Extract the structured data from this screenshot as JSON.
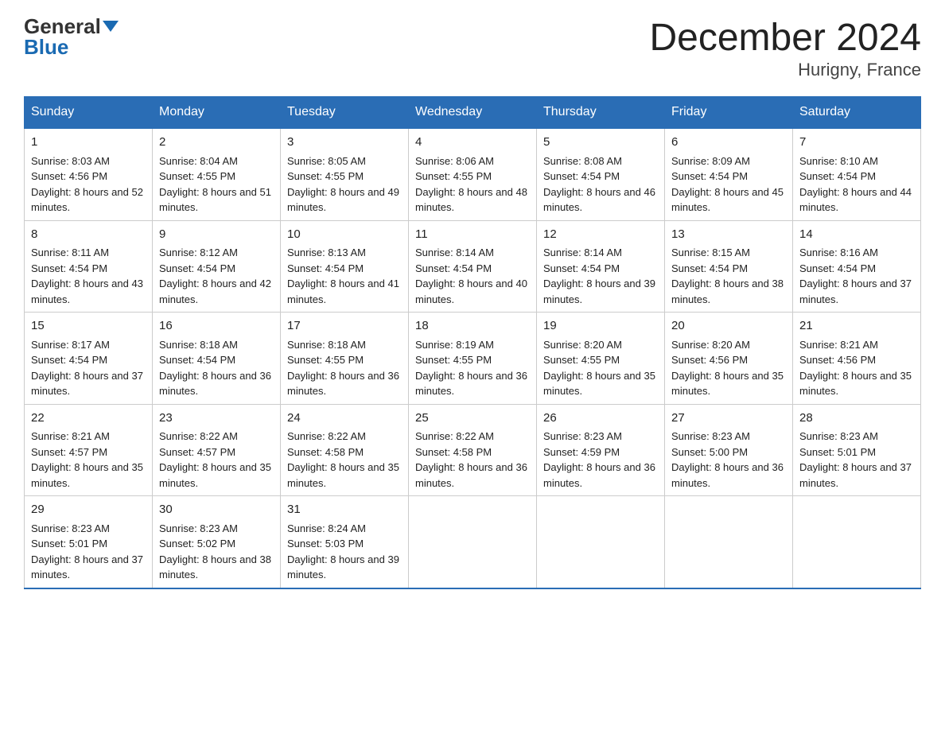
{
  "header": {
    "logo_general": "General",
    "logo_blue": "Blue",
    "month_title": "December 2024",
    "location": "Hurigny, France"
  },
  "days_of_week": [
    "Sunday",
    "Monday",
    "Tuesday",
    "Wednesday",
    "Thursday",
    "Friday",
    "Saturday"
  ],
  "weeks": [
    [
      {
        "day": "1",
        "sunrise": "8:03 AM",
        "sunset": "4:56 PM",
        "daylight": "8 hours and 52 minutes."
      },
      {
        "day": "2",
        "sunrise": "8:04 AM",
        "sunset": "4:55 PM",
        "daylight": "8 hours and 51 minutes."
      },
      {
        "day": "3",
        "sunrise": "8:05 AM",
        "sunset": "4:55 PM",
        "daylight": "8 hours and 49 minutes."
      },
      {
        "day": "4",
        "sunrise": "8:06 AM",
        "sunset": "4:55 PM",
        "daylight": "8 hours and 48 minutes."
      },
      {
        "day": "5",
        "sunrise": "8:08 AM",
        "sunset": "4:54 PM",
        "daylight": "8 hours and 46 minutes."
      },
      {
        "day": "6",
        "sunrise": "8:09 AM",
        "sunset": "4:54 PM",
        "daylight": "8 hours and 45 minutes."
      },
      {
        "day": "7",
        "sunrise": "8:10 AM",
        "sunset": "4:54 PM",
        "daylight": "8 hours and 44 minutes."
      }
    ],
    [
      {
        "day": "8",
        "sunrise": "8:11 AM",
        "sunset": "4:54 PM",
        "daylight": "8 hours and 43 minutes."
      },
      {
        "day": "9",
        "sunrise": "8:12 AM",
        "sunset": "4:54 PM",
        "daylight": "8 hours and 42 minutes."
      },
      {
        "day": "10",
        "sunrise": "8:13 AM",
        "sunset": "4:54 PM",
        "daylight": "8 hours and 41 minutes."
      },
      {
        "day": "11",
        "sunrise": "8:14 AM",
        "sunset": "4:54 PM",
        "daylight": "8 hours and 40 minutes."
      },
      {
        "day": "12",
        "sunrise": "8:14 AM",
        "sunset": "4:54 PM",
        "daylight": "8 hours and 39 minutes."
      },
      {
        "day": "13",
        "sunrise": "8:15 AM",
        "sunset": "4:54 PM",
        "daylight": "8 hours and 38 minutes."
      },
      {
        "day": "14",
        "sunrise": "8:16 AM",
        "sunset": "4:54 PM",
        "daylight": "8 hours and 37 minutes."
      }
    ],
    [
      {
        "day": "15",
        "sunrise": "8:17 AM",
        "sunset": "4:54 PM",
        "daylight": "8 hours and 37 minutes."
      },
      {
        "day": "16",
        "sunrise": "8:18 AM",
        "sunset": "4:54 PM",
        "daylight": "8 hours and 36 minutes."
      },
      {
        "day": "17",
        "sunrise": "8:18 AM",
        "sunset": "4:55 PM",
        "daylight": "8 hours and 36 minutes."
      },
      {
        "day": "18",
        "sunrise": "8:19 AM",
        "sunset": "4:55 PM",
        "daylight": "8 hours and 36 minutes."
      },
      {
        "day": "19",
        "sunrise": "8:20 AM",
        "sunset": "4:55 PM",
        "daylight": "8 hours and 35 minutes."
      },
      {
        "day": "20",
        "sunrise": "8:20 AM",
        "sunset": "4:56 PM",
        "daylight": "8 hours and 35 minutes."
      },
      {
        "day": "21",
        "sunrise": "8:21 AM",
        "sunset": "4:56 PM",
        "daylight": "8 hours and 35 minutes."
      }
    ],
    [
      {
        "day": "22",
        "sunrise": "8:21 AM",
        "sunset": "4:57 PM",
        "daylight": "8 hours and 35 minutes."
      },
      {
        "day": "23",
        "sunrise": "8:22 AM",
        "sunset": "4:57 PM",
        "daylight": "8 hours and 35 minutes."
      },
      {
        "day": "24",
        "sunrise": "8:22 AM",
        "sunset": "4:58 PM",
        "daylight": "8 hours and 35 minutes."
      },
      {
        "day": "25",
        "sunrise": "8:22 AM",
        "sunset": "4:58 PM",
        "daylight": "8 hours and 36 minutes."
      },
      {
        "day": "26",
        "sunrise": "8:23 AM",
        "sunset": "4:59 PM",
        "daylight": "8 hours and 36 minutes."
      },
      {
        "day": "27",
        "sunrise": "8:23 AM",
        "sunset": "5:00 PM",
        "daylight": "8 hours and 36 minutes."
      },
      {
        "day": "28",
        "sunrise": "8:23 AM",
        "sunset": "5:01 PM",
        "daylight": "8 hours and 37 minutes."
      }
    ],
    [
      {
        "day": "29",
        "sunrise": "8:23 AM",
        "sunset": "5:01 PM",
        "daylight": "8 hours and 37 minutes."
      },
      {
        "day": "30",
        "sunrise": "8:23 AM",
        "sunset": "5:02 PM",
        "daylight": "8 hours and 38 minutes."
      },
      {
        "day": "31",
        "sunrise": "8:24 AM",
        "sunset": "5:03 PM",
        "daylight": "8 hours and 39 minutes."
      },
      null,
      null,
      null,
      null
    ]
  ],
  "labels": {
    "sunrise": "Sunrise:",
    "sunset": "Sunset:",
    "daylight": "Daylight:"
  }
}
